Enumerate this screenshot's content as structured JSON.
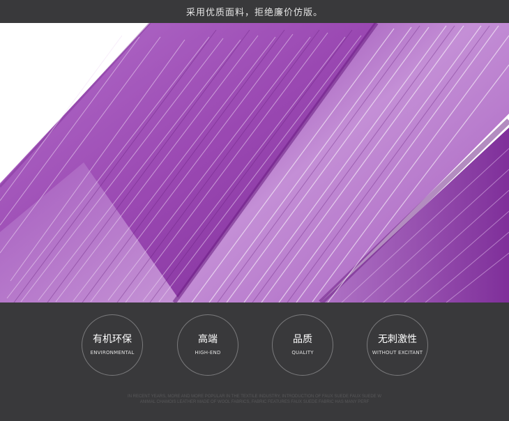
{
  "banner": {
    "text": "采用优质面料，拒绝廉价仿版。"
  },
  "product_image": {
    "subject": "purple crinkled silk fabric",
    "colors": {
      "base": "#9c4ab3",
      "highlight": "#e6cdee",
      "shadow": "#6d1f86"
    }
  },
  "features": [
    {
      "zh": "有机环保",
      "en": "ENVIRONMENTAL"
    },
    {
      "zh": "高端",
      "en": "HIGH-END"
    },
    {
      "zh": "品质",
      "en": "QUALITY"
    },
    {
      "zh": "无刺激性",
      "en": "WITHOUT EXCITANT"
    }
  ],
  "fine_print": {
    "line1": "IN RECENT YEARS, MORE AND MORE POPULAR IN THE TEXTILE INDUSTRY, INTRODUCTION OF FAUX SUEDE FAUX SUEDE W",
    "line2": "ANIMAL CHAMOIS LEATHER MADE OF WOOL FABRICS, FABRIC FEATURES FAUX SUEDE FABRIC HAS MANY PERF"
  }
}
